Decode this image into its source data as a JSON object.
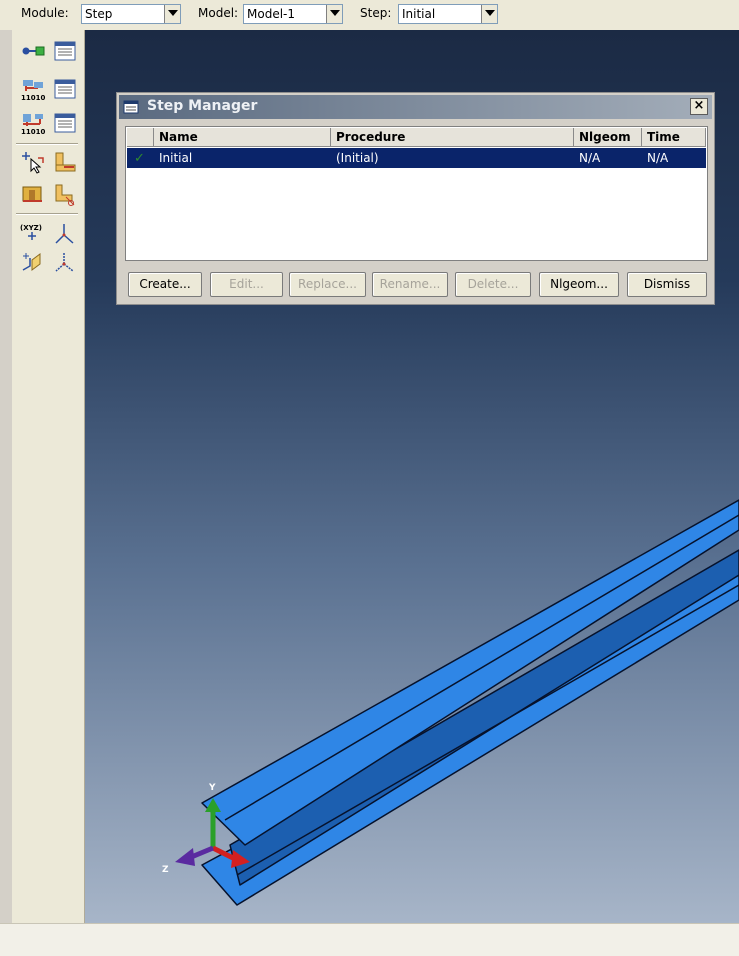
{
  "context_bar": {
    "module_label": "Module:",
    "module_value": "Step",
    "model_label": "Model:",
    "model_value": "Model-1",
    "step_label": "Step:",
    "step_value": "Initial"
  },
  "toolbox": {
    "tools": [
      "create-step-icon",
      "step-manager-icon",
      "field-output-request-icon",
      "field-output-manager-icon",
      "history-output-request-icon",
      "history-output-manager-icon",
      "set-icon",
      "surface-icon",
      "partition-cell-icon",
      "partition-face-icon",
      "datum-point-icon",
      "datum-axis-icon",
      "datum-plane-icon",
      "datum-csys-icon"
    ],
    "xyz_glyph": "(XYZ)"
  },
  "dialog": {
    "title": "Step Manager",
    "close_glyph": "×",
    "columns": [
      "Name",
      "Procedure",
      "Nlgeom",
      "Time"
    ],
    "rows": [
      {
        "check": "✓",
        "name": "Initial",
        "procedure": "(Initial)",
        "nlgeom": "N/A",
        "time": "N/A"
      }
    ],
    "buttons": [
      {
        "label": "Create...",
        "enabled": true
      },
      {
        "label": "Edit...",
        "enabled": false
      },
      {
        "label": "Replace...",
        "enabled": false
      },
      {
        "label": "Rename...",
        "enabled": false
      },
      {
        "label": "Delete...",
        "enabled": false
      },
      {
        "label": "Nlgeom...",
        "enabled": true
      },
      {
        "label": "Dismiss",
        "enabled": true
      }
    ]
  },
  "viewport": {
    "triad": {
      "y_label": "Y",
      "z_label": "Z"
    },
    "colors": {
      "beam_face": "#2f86e6",
      "beam_web": "#1c5fb0",
      "beam_edge": "#06122c",
      "axis_x": "#d42020",
      "axis_y": "#2aa02a",
      "axis_z": "#5a2aa0"
    }
  }
}
